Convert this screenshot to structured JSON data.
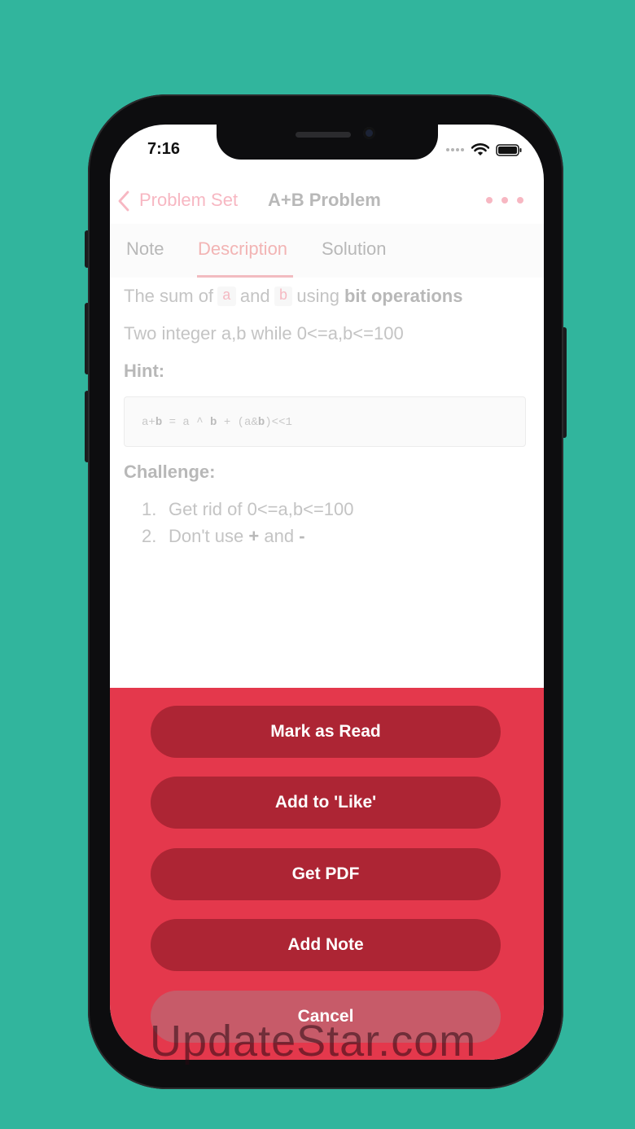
{
  "status_bar": {
    "time": "7:16",
    "icons": [
      "signal-dots-icon",
      "wifi-icon",
      "battery-icon"
    ]
  },
  "navbar": {
    "back_label": "Problem Set",
    "title": "A+B Problem",
    "more_icon": "more-dots-icon"
  },
  "tabs": [
    {
      "label": "Note",
      "active": false
    },
    {
      "label": "Description",
      "active": true
    },
    {
      "label": "Solution",
      "active": false
    }
  ],
  "description": {
    "line1": {
      "part1": "The sum of",
      "code_a": "a",
      "part2": "and",
      "code_b": "b",
      "part3": "using",
      "bold": "bit operations"
    },
    "line2": "Two integer a,b while 0<=a,b<=100",
    "hint_heading": "Hint:",
    "hint_code": {
      "part1": "a+",
      "bold1": "b",
      "part2": " = a ^ ",
      "bold2": "b",
      "part3": " + (a&",
      "bold3": "b",
      "part4": ")<<1"
    },
    "challenge_heading": "Challenge:",
    "challenges": [
      {
        "num": "1.",
        "text": "Get rid of 0<=a,b<=100"
      },
      {
        "num": "2.",
        "text_start": "Don't use",
        "bold_plus": "+",
        "text_mid": "and",
        "bold_minus": "-"
      }
    ]
  },
  "action_sheet": {
    "buttons": [
      "Mark as Read",
      "Add to 'Like'",
      "Get PDF",
      "Add Note"
    ],
    "cancel": "Cancel"
  },
  "watermark": "UpdateStar.com",
  "colors": {
    "background": "#31b59d",
    "accent_pink": "#f7b7c2",
    "sheet_red": "#e4384c",
    "button_red": "#ad2534"
  }
}
